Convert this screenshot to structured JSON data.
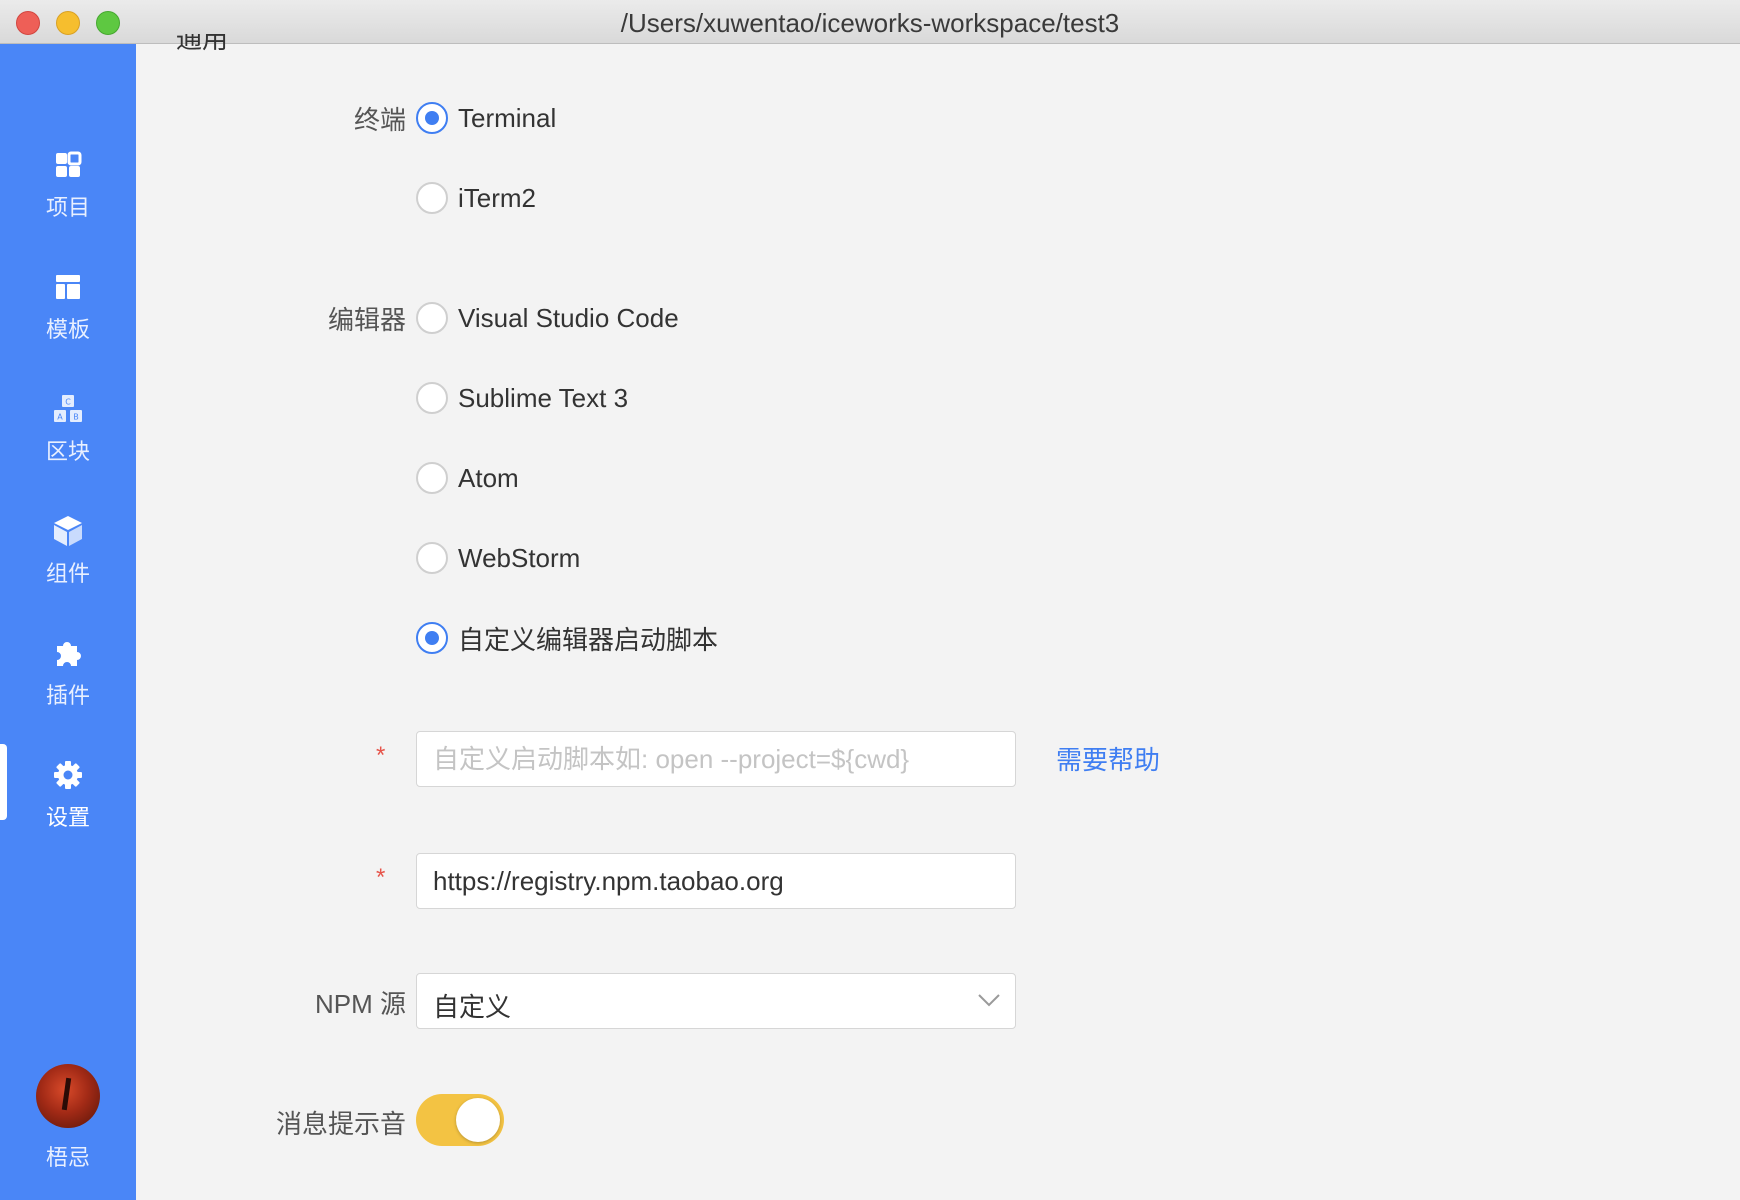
{
  "window": {
    "title": "/Users/xuwentao/iceworks-workspace/test3",
    "traffic_lights": [
      "close",
      "minimize",
      "maximize"
    ]
  },
  "sidebar": {
    "items": [
      {
        "label": "项目",
        "icon": "grid-icon"
      },
      {
        "label": "模板",
        "icon": "layout-icon"
      },
      {
        "label": "区块",
        "icon": "blocks-abc-icon"
      },
      {
        "label": "组件",
        "icon": "cube-icon"
      },
      {
        "label": "插件",
        "icon": "puzzle-icon"
      },
      {
        "label": "设置",
        "icon": "gear-icon",
        "active": true
      }
    ],
    "user": {
      "name": "梧忌"
    }
  },
  "main": {
    "section_title": "通用",
    "terminal": {
      "label": "终端",
      "options": [
        {
          "label": "Terminal",
          "checked": true
        },
        {
          "label": "iTerm2",
          "checked": false
        }
      ]
    },
    "editor": {
      "label": "编辑器",
      "options": [
        {
          "label": "Visual Studio Code",
          "checked": false
        },
        {
          "label": "Sublime Text 3",
          "checked": false
        },
        {
          "label": "Atom",
          "checked": false
        },
        {
          "label": "WebStorm",
          "checked": false
        },
        {
          "label": "自定义编辑器启动脚本",
          "checked": true
        }
      ]
    },
    "custom_script": {
      "required_mark": "*",
      "placeholder": "自定义启动脚本如: open --project=${cwd}",
      "value": "",
      "help_link": "需要帮助"
    },
    "registry": {
      "required_mark": "*",
      "value": "https://registry.npm.taobao.org"
    },
    "npm_source": {
      "label": "NPM 源",
      "selected": "自定义"
    },
    "notification_sound": {
      "label": "消息提示音",
      "enabled": true
    }
  },
  "colors": {
    "sidebar_bg": "#4a86f7",
    "accent": "#3f7ef2",
    "toggle_on": "#f3c343",
    "required": "#e6544a"
  }
}
